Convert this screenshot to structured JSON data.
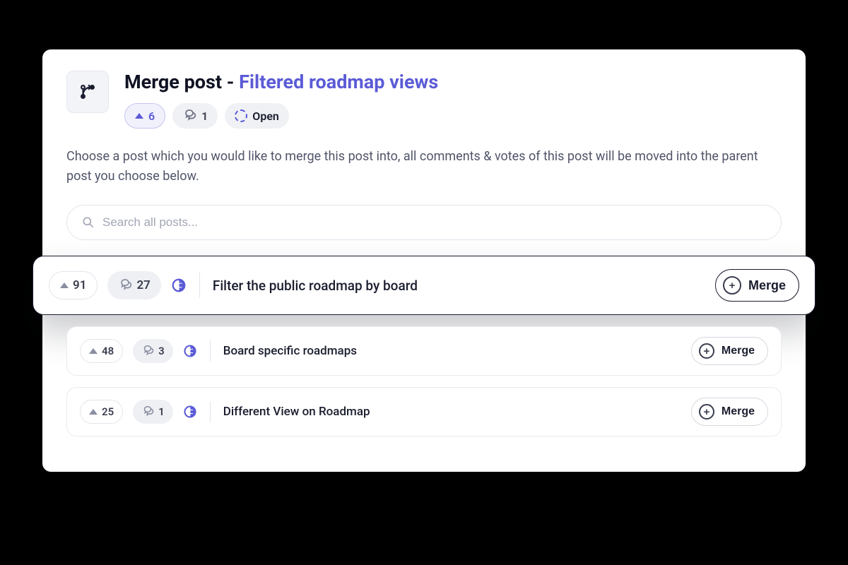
{
  "header": {
    "title_prefix": "Merge post - ",
    "title_name": "Filtered roadmap views",
    "upvotes": "6",
    "comments": "1",
    "status_label": "Open"
  },
  "description": "Choose a post which you would like to merge this post into, all comments & votes of this post will be moved into the parent post you choose below.",
  "search": {
    "placeholder": "Search all posts..."
  },
  "results": [
    {
      "upvotes": "91",
      "comments": "27",
      "title": "Filter the public roadmap by board",
      "merge_label": "Merge"
    },
    {
      "upvotes": "48",
      "comments": "3",
      "title": "Board specific roadmaps",
      "merge_label": "Merge"
    },
    {
      "upvotes": "25",
      "comments": "1",
      "title": "Different View on Roadmap",
      "merge_label": "Merge"
    }
  ]
}
